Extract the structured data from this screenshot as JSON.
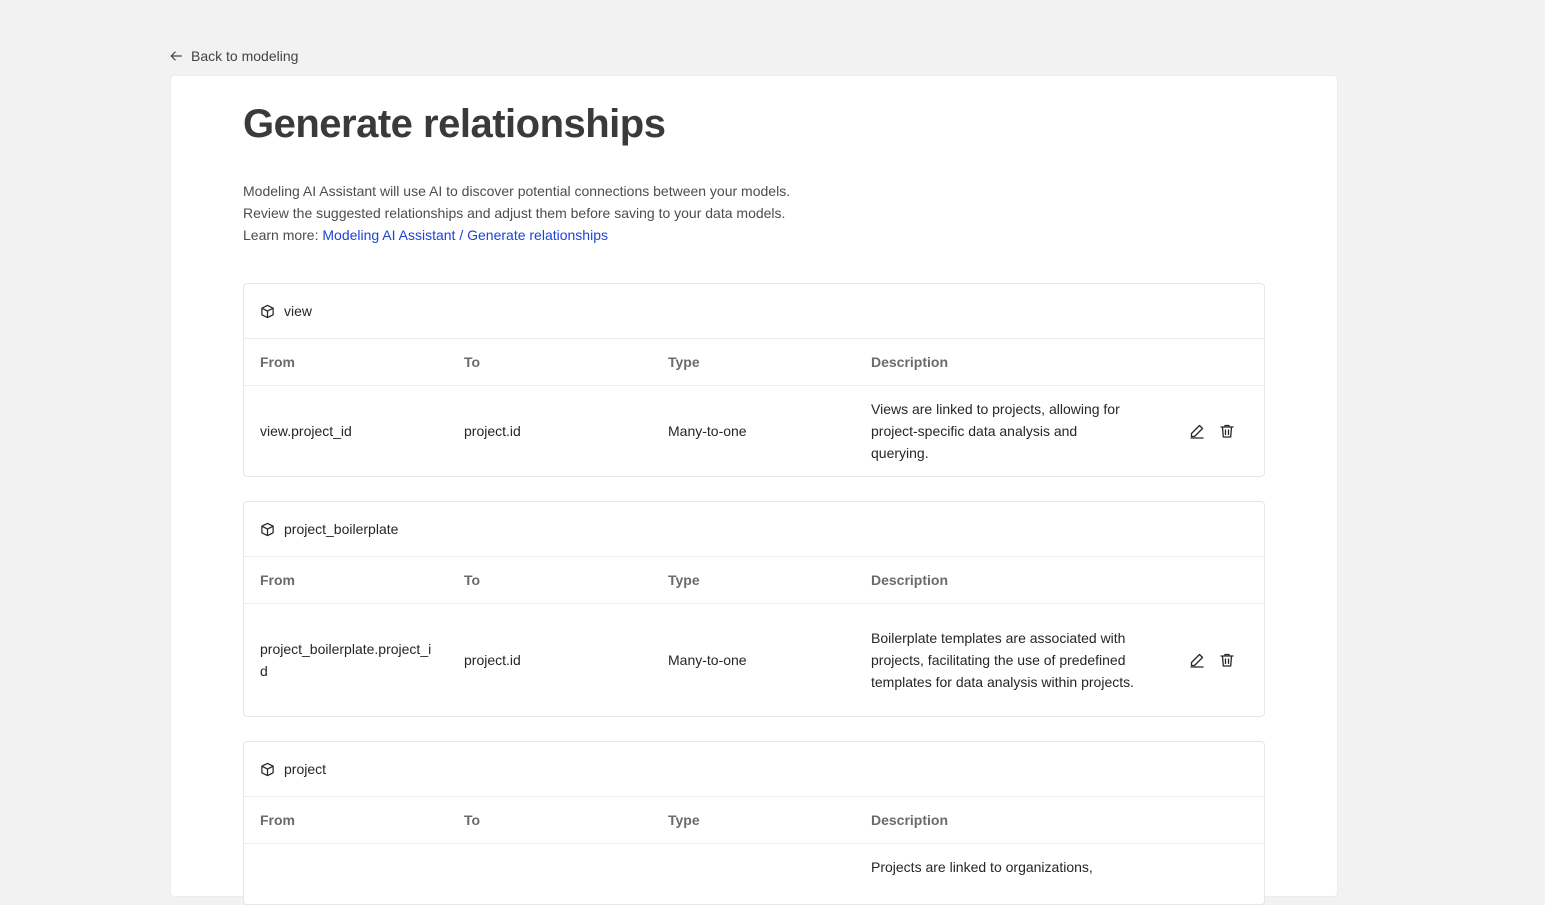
{
  "back_link": {
    "label": "Back to modeling"
  },
  "page": {
    "title": "Generate relationships",
    "description_lines": [
      "Modeling AI Assistant will use AI to discover potential connections between your models.",
      "Review the suggested relationships and adjust them before saving to your data models."
    ],
    "learn_more_prefix": "Learn more: ",
    "learn_more_link": "Modeling AI Assistant / Generate relationships"
  },
  "columns": {
    "from": "From",
    "to": "To",
    "type": "Type",
    "description": "Description"
  },
  "groups": [
    {
      "name": "view",
      "rows": [
        {
          "from": "view.project_id",
          "to": "project.id",
          "type": "Many-to-one",
          "description": "Views are linked to projects, allowing for project-specific data analysis and querying."
        }
      ]
    },
    {
      "name": "project_boilerplate",
      "rows": [
        {
          "from": "project_boilerplate.project_id",
          "to": "project.id",
          "type": "Many-to-one",
          "description": "Boilerplate templates are associated with projects, facilitating the use of predefined templates for data analysis within projects."
        }
      ]
    },
    {
      "name": "project",
      "rows": [
        {
          "from": "",
          "to": "",
          "type": "",
          "description": "Projects are linked to organizations,"
        }
      ]
    }
  ],
  "icons": {
    "back": "arrow-left-icon",
    "model": "cube-icon",
    "edit": "edit-icon",
    "delete": "delete-icon"
  },
  "colors": {
    "link": "#1c44d4",
    "background": "#f2f2f2"
  }
}
